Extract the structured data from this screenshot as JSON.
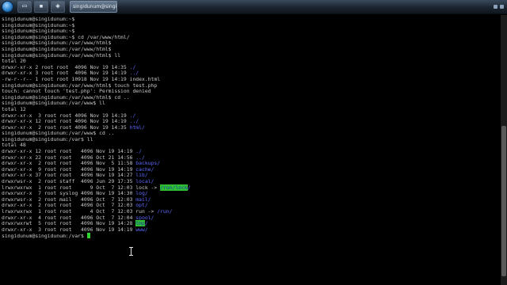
{
  "taskbar": {
    "window_title": "singidunum@singidunum: /var",
    "pinned": [
      {
        "name": "explorer-button",
        "glyph": "▭"
      },
      {
        "name": "terminal-button",
        "glyph": "▪"
      },
      {
        "name": "virtualbox-button",
        "glyph": "◈"
      }
    ]
  },
  "terminal": {
    "lines": [
      {
        "segs": [
          {
            "t": "singidunum@singidunum:~$"
          }
        ]
      },
      {
        "segs": [
          {
            "t": "singidunum@singidunum:~$"
          }
        ]
      },
      {
        "segs": [
          {
            "t": "singidunum@singidunum:~$"
          }
        ]
      },
      {
        "segs": [
          {
            "t": "singidunum@singidunum:~$ cd /var/www/html/"
          }
        ]
      },
      {
        "segs": [
          {
            "t": "singidunum@singidunum:/var/www/html$"
          }
        ]
      },
      {
        "segs": [
          {
            "t": "singidunum@singidunum:/var/www/html$"
          }
        ]
      },
      {
        "segs": [
          {
            "t": "singidunum@singidunum:/var/www/html$ ll"
          }
        ]
      },
      {
        "segs": [
          {
            "t": "total 20"
          }
        ]
      },
      {
        "segs": [
          {
            "t": "drwxr-xr-x 2 root root  4096 Nov 19 14:35 "
          },
          {
            "t": "./",
            "c": "dir"
          }
        ]
      },
      {
        "segs": [
          {
            "t": "drwxr-xr-x 3 root root  4096 Nov 19 14:19 "
          },
          {
            "t": "../",
            "c": "dir"
          }
        ]
      },
      {
        "segs": [
          {
            "t": "-rw-r--r-- 1 root root 10918 Nov 19 14:19 index.html"
          }
        ]
      },
      {
        "segs": [
          {
            "t": "singidunum@singidunum:/var/www/html$ touch test.php"
          }
        ]
      },
      {
        "segs": [
          {
            "t": "touch: cannot touch 'test.php': Permission denied"
          }
        ]
      },
      {
        "segs": [
          {
            "t": "singidunum@singidunum:/var/www/html$ cd .."
          }
        ]
      },
      {
        "segs": [
          {
            "t": "singidunum@singidunum:/var/www$ ll"
          }
        ]
      },
      {
        "segs": [
          {
            "t": "total 12"
          }
        ]
      },
      {
        "segs": [
          {
            "t": "drwxr-xr-x  3 root root 4096 Nov 19 14:19 "
          },
          {
            "t": "./",
            "c": "dir"
          }
        ]
      },
      {
        "segs": [
          {
            "t": "drwxr-xr-x 12 root root 4096 Nov 19 14:19 "
          },
          {
            "t": "../",
            "c": "dir"
          }
        ]
      },
      {
        "segs": [
          {
            "t": "drwxr-xr-x  2 root root 4096 Nov 19 14:35 "
          },
          {
            "t": "html/",
            "c": "dir"
          }
        ]
      },
      {
        "segs": [
          {
            "t": "singidunum@singidunum:/var/www$ cd .."
          }
        ]
      },
      {
        "segs": [
          {
            "t": "singidunum@singidunum:/var$ ll"
          }
        ]
      },
      {
        "segs": [
          {
            "t": "total 48"
          }
        ]
      },
      {
        "segs": [
          {
            "t": "drwxr-xr-x 12 root root   4096 Nov 19 14:19 "
          },
          {
            "t": "./",
            "c": "dir"
          }
        ]
      },
      {
        "segs": [
          {
            "t": "drwxr-xr-x 22 root root   4096 Oct 21 14:56 "
          },
          {
            "t": "../",
            "c": "dir"
          }
        ]
      },
      {
        "segs": [
          {
            "t": "drwxr-xr-x  2 root root   4096 Nov  5 11:58 "
          },
          {
            "t": "backups/",
            "c": "dir"
          }
        ]
      },
      {
        "segs": [
          {
            "t": "drwxr-xr-x  9 root root   4096 Nov 19 14:19 "
          },
          {
            "t": "cache/",
            "c": "dir"
          }
        ]
      },
      {
        "segs": [
          {
            "t": "drwxr-xr-x 37 root root   4096 Nov 19 14:27 "
          },
          {
            "t": "lib/",
            "c": "dir"
          }
        ]
      },
      {
        "segs": [
          {
            "t": "drwxrwsr-x  2 root staff  4096 Jun 29 17:35 "
          },
          {
            "t": "local/",
            "c": "dir"
          }
        ]
      },
      {
        "segs": [
          {
            "t": "lrwxrwxrwx  1 root root      9 Oct  7 12:03 lock -> "
          },
          {
            "t": "/run/lock",
            "c": "hl"
          },
          {
            "t": "/",
            "c": "dir"
          }
        ]
      },
      {
        "segs": [
          {
            "t": "drwxrwxr-x  7 root syslog 4096 Nov 19 14:30 "
          },
          {
            "t": "log/",
            "c": "dir"
          }
        ]
      },
      {
        "segs": [
          {
            "t": "drwxrwsr-x  2 root mail   4096 Oct  7 12:03 "
          },
          {
            "t": "mail/",
            "c": "dir"
          }
        ]
      },
      {
        "segs": [
          {
            "t": "drwxr-xr-x  2 root root   4096 Oct  7 12:03 "
          },
          {
            "t": "opt/",
            "c": "dir"
          }
        ]
      },
      {
        "segs": [
          {
            "t": "lrwxrwxrwx  1 root root      4 Oct  7 12:03 run -> "
          },
          {
            "t": "/run/",
            "c": "dir"
          }
        ]
      },
      {
        "segs": [
          {
            "t": "drwxr-xr-x  4 root root   4096 Oct  7 12:04 "
          },
          {
            "t": "spool/",
            "c": "dir"
          }
        ]
      },
      {
        "segs": [
          {
            "t": "drwxrwxrwt  5 root root   4096 Nov 19 14:28 "
          },
          {
            "t": "tmp",
            "c": "hl"
          },
          {
            "t": "/",
            "c": "dir"
          }
        ]
      },
      {
        "segs": [
          {
            "t": "drwxr-xr-x  3 root root   4096 Nov 19 14:19 "
          },
          {
            "t": "www/",
            "c": "dir"
          }
        ]
      },
      {
        "segs": [
          {
            "t": "singidunum@singidunum:/var$ "
          }
        ],
        "cursor": true
      }
    ]
  },
  "colors": {
    "background": "#000000",
    "text": "#c8c8c8",
    "directory": "#5f6bff",
    "highlight_bg": "#2fbf2f",
    "cursor": "#31d331"
  }
}
